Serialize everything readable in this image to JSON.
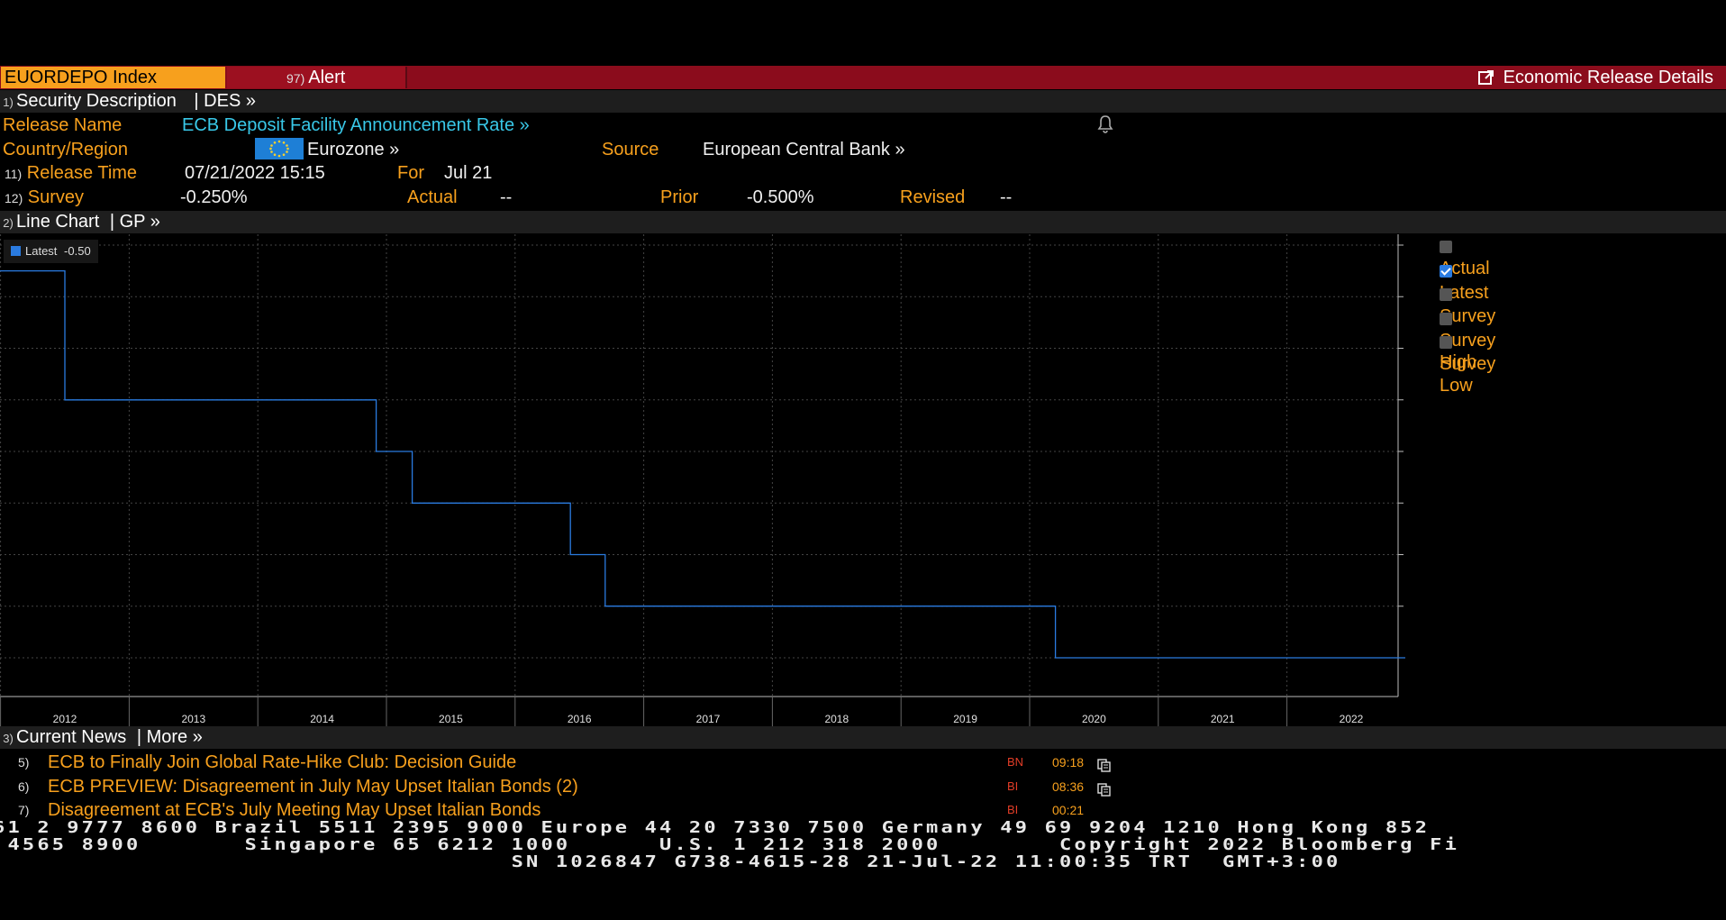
{
  "header": {
    "ticker": "EUORDEPO Index",
    "alert_num": "97)",
    "alert_label": "Alert",
    "details_label": "Economic Release Details"
  },
  "security_description": {
    "num": "1)",
    "label": "Security Description",
    "code": "| DES  »"
  },
  "release": {
    "name_label": "Release Name",
    "name_value": "ECB Deposit Facility Announcement Rate »",
    "country_label": "Country/Region",
    "country_value": "Eurozone »",
    "source_label": "Source",
    "source_value": "European Central Bank »",
    "time_num": "11)",
    "time_label": "Release Time",
    "time_value": "07/21/2022 15:15",
    "for_label": "For",
    "for_value": "Jul 21",
    "survey_num": "12)",
    "survey_label": "Survey",
    "survey_value": "-0.250%",
    "actual_label": "Actual",
    "actual_value": "--",
    "prior_label": "Prior",
    "prior_value": "-0.500%",
    "revised_label": "Revised",
    "revised_value": "--",
    "bell_icon": "bell-icon"
  },
  "line_chart_header": {
    "num": "2)",
    "label": "Line Chart",
    "code": "| GP  »"
  },
  "legend_pill": {
    "label": "Latest",
    "value": "-0.50",
    "color": "#2a7be0"
  },
  "series_toggles": [
    {
      "label": "Actual",
      "checked": false
    },
    {
      "label": "Latest",
      "checked": true
    },
    {
      "label": "Survey",
      "checked": false
    },
    {
      "label": "Survey High",
      "checked": false
    },
    {
      "label": "Survey Low",
      "checked": false
    }
  ],
  "chart_data": {
    "type": "line",
    "step": true,
    "series": [
      {
        "name": "Latest",
        "color": "#2a7be0",
        "points": [
          {
            "x": 2011.0,
            "y": 0.25
          },
          {
            "x": 2012.0,
            "y": 0.25
          },
          {
            "x": 2012.0,
            "y": 0.0
          },
          {
            "x": 2014.42,
            "y": 0.0
          },
          {
            "x": 2014.42,
            "y": -0.1
          },
          {
            "x": 2014.7,
            "y": -0.1
          },
          {
            "x": 2014.7,
            "y": -0.2
          },
          {
            "x": 2015.93,
            "y": -0.2
          },
          {
            "x": 2015.93,
            "y": -0.3
          },
          {
            "x": 2016.2,
            "y": -0.3
          },
          {
            "x": 2016.2,
            "y": -0.4
          },
          {
            "x": 2019.7,
            "y": -0.4
          },
          {
            "x": 2019.7,
            "y": -0.5
          },
          {
            "x": 2022.55,
            "y": -0.5
          }
        ]
      }
    ],
    "x_ticks": [
      "2012",
      "2013",
      "2014",
      "2015",
      "2016",
      "2017",
      "2018",
      "2019",
      "2020",
      "2021",
      "2022"
    ],
    "y_ticks": [
      "0.30",
      "0.20",
      "0.10",
      "0.00",
      "-0.10",
      "-0.20",
      "-0.30",
      "-0.40",
      "-0.50"
    ],
    "ylim": [
      -0.57,
      0.32
    ],
    "xlim": [
      2011.5,
      2022.65
    ],
    "grid": true,
    "legend": "top-left"
  },
  "news_header": {
    "num": "3)",
    "label": "Current News",
    "code": "| More  »"
  },
  "news": [
    {
      "idx": "5)",
      "headline": "ECB to Finally Join Global Rate-Hike Club: Decision Guide",
      "source": "BN",
      "time": "09:18",
      "has_icon": true
    },
    {
      "idx": "6)",
      "headline": "ECB PREVIEW: Disagreement in July May Upset Italian Bonds (2)",
      "source": "BI",
      "time": "08:36",
      "has_icon": true
    },
    {
      "idx": "7)",
      "headline": "Disagreement at ECB's July Meeting May Upset Italian Bonds",
      "source": "BI",
      "time": "00:21",
      "has_icon": false
    }
  ],
  "footer": {
    "line1": "61 2 9777 8600 Brazil 5511 2395 9000 Europe 44 20 7330 7500 Germany 49 69 9204 1210 Hong Kong 852",
    "line2": " 4565 8900       Singapore 65 6212 1000      U.S. 1 212 318 2000        Copyright 2022 Bloomberg Fi",
    "line3": "                                   SN 1026847 G738-4615-28 21-Jul-22 11:00:35 TRT  GMT+3:00"
  }
}
